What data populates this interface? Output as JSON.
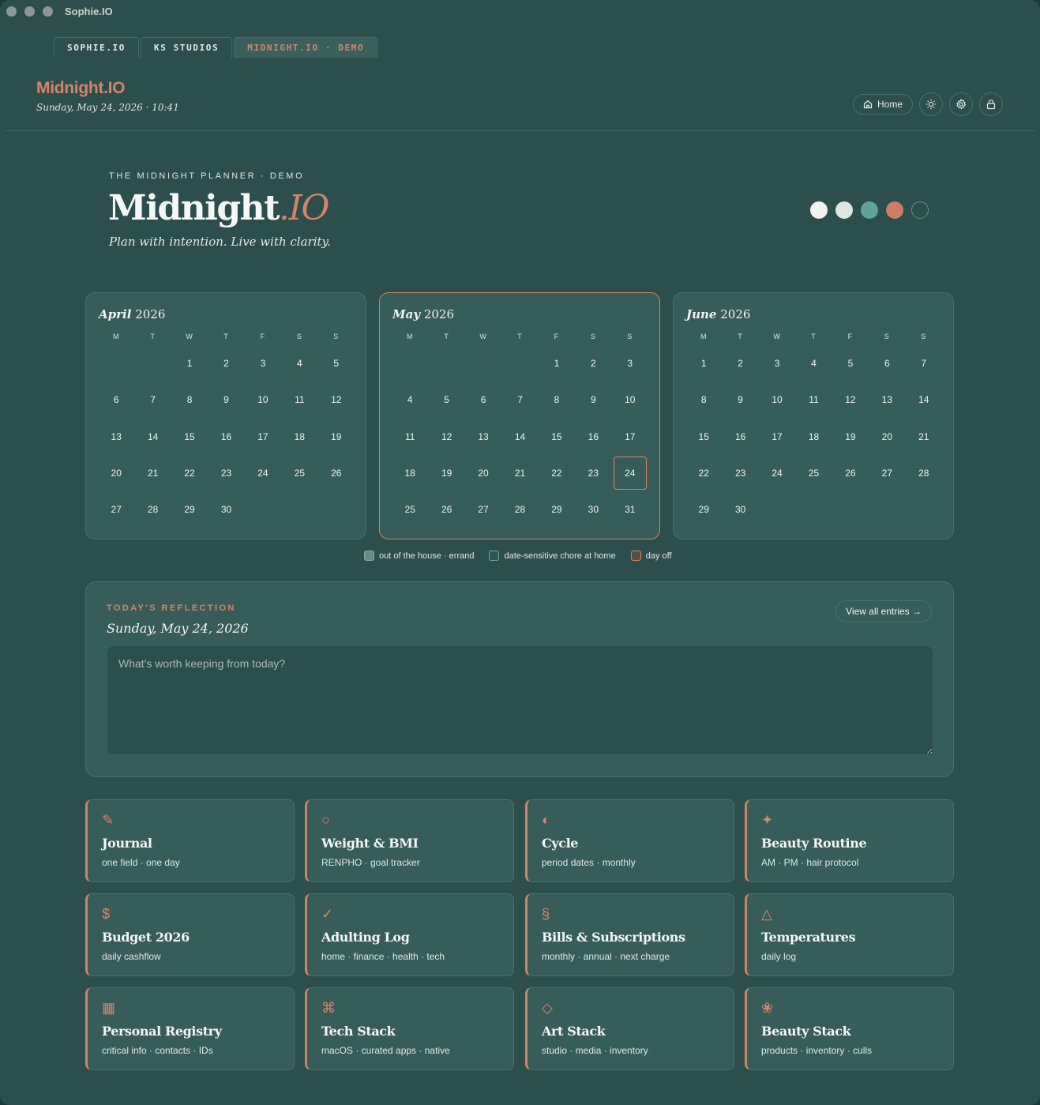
{
  "window": {
    "title": "Sophie.IO"
  },
  "tabs": [
    {
      "label": "SOPHIE.IO",
      "active": false
    },
    {
      "label": "KS STUDIOS",
      "active": false
    },
    {
      "label": "MIDNIGHT.IO · DEMO",
      "active": true
    }
  ],
  "header": {
    "brand": "Midnight.IO",
    "datetime": "Sunday, May 24, 2026 · 10:41",
    "home_label": "Home",
    "icons": [
      "sun-icon",
      "gear-icon",
      "lock-icon"
    ]
  },
  "hero": {
    "eyebrow": "THE MIDNIGHT PLANNER · DEMO",
    "title_main": "Midnight",
    "title_accent": ".IO",
    "tagline": "Plan with intention. Live with clarity.",
    "swatches": [
      "#f2f2f0",
      "#dce6e3",
      "#5ea39a",
      "#cf7e64",
      "#2c4e4c"
    ]
  },
  "calendars": [
    {
      "month": "April",
      "year": "2026",
      "offset": 2,
      "days": 30,
      "today": null,
      "current": false
    },
    {
      "month": "May",
      "year": "2026",
      "offset": 4,
      "days": 31,
      "today": 24,
      "current": true
    },
    {
      "month": "June",
      "year": "2026",
      "offset": 0,
      "days": 30,
      "today": null,
      "current": false
    }
  ],
  "weekdays": [
    "M",
    "T",
    "W",
    "T",
    "F",
    "S",
    "S"
  ],
  "legend": [
    {
      "label": "out of the house · errand",
      "color": "#6b8a86",
      "border": "#93aaa6"
    },
    {
      "label": "date-sensitive chore at home",
      "color": "#2f5552",
      "border": "#6fa39b"
    },
    {
      "label": "day off",
      "color": "#5a4f45",
      "border": "#c98568"
    }
  ],
  "reflection": {
    "eyebrow": "TODAY'S REFLECTION",
    "date": "Sunday, May 24, 2026",
    "view_all": "View all entries →",
    "placeholder": "What's worth keeping from today?"
  },
  "cards": [
    {
      "icon": "✎",
      "icon_name": "pencil-icon",
      "title": "Journal",
      "sub": "one field · one day"
    },
    {
      "icon": "○",
      "icon_name": "circle-icon",
      "title": "Weight & BMI",
      "sub": "RENPHO · goal tracker"
    },
    {
      "icon": "◐",
      "icon_name": "half-circle-icon",
      "title": "Cycle",
      "sub": "period dates · monthly"
    },
    {
      "icon": "✦",
      "icon_name": "sparkle-icon",
      "title": "Beauty Routine",
      "sub": "AM · PM · hair protocol"
    },
    {
      "icon": "$",
      "icon_name": "dollar-icon",
      "title": "Budget 2026",
      "sub": "daily cashflow"
    },
    {
      "icon": "✓",
      "icon_name": "check-icon",
      "title": "Adulting Log",
      "sub": "home · finance · health · tech"
    },
    {
      "icon": "§",
      "icon_name": "section-icon",
      "title": "Bills & Subscriptions",
      "sub": "monthly · annual · next charge"
    },
    {
      "icon": "△",
      "icon_name": "triangle-icon",
      "title": "Temperatures",
      "sub": "daily log"
    },
    {
      "icon": "▦",
      "icon_name": "grid-icon",
      "title": "Personal Registry",
      "sub": "critical info · contacts · IDs"
    },
    {
      "icon": "⌘",
      "icon_name": "command-icon",
      "title": "Tech Stack",
      "sub": "macOS · curated apps · native"
    },
    {
      "icon": "◇",
      "icon_name": "diamond-icon",
      "title": "Art Stack",
      "sub": "studio · media · inventory"
    },
    {
      "icon": "❀",
      "icon_name": "flower-icon",
      "title": "Beauty Stack",
      "sub": "products · inventory · culls"
    }
  ]
}
